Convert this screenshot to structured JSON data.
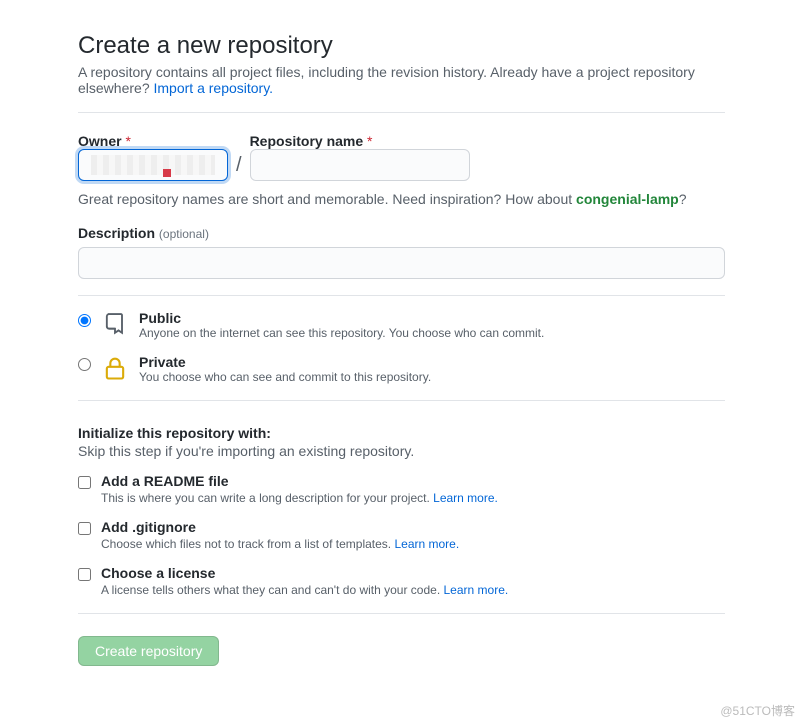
{
  "header": {
    "title": "Create a new repository",
    "subhead_prefix": "A repository contains all project files, including the revision history. Already have a project repository elsewhere? ",
    "import_link": "Import a repository."
  },
  "owner": {
    "label": "Owner",
    "required": "*"
  },
  "repo_name": {
    "label": "Repository name",
    "required": "*"
  },
  "slash": "/",
  "name_hint_prefix": "Great repository names are short and memorable. Need inspiration? How about ",
  "name_suggestion": "congenial-lamp",
  "name_hint_suffix": "?",
  "description": {
    "label": "Description",
    "optional": "(optional)"
  },
  "visibility": {
    "public": {
      "title": "Public",
      "desc": "Anyone on the internet can see this repository. You choose who can commit."
    },
    "private": {
      "title": "Private",
      "desc": "You choose who can see and commit to this repository."
    }
  },
  "init": {
    "title": "Initialize this repository with:",
    "sub": "Skip this step if you're importing an existing repository.",
    "readme": {
      "title": "Add a README file",
      "desc": "This is where you can write a long description for your project. ",
      "learn": "Learn more."
    },
    "gitignore": {
      "title": "Add .gitignore",
      "desc": "Choose which files not to track from a list of templates. ",
      "learn": "Learn more."
    },
    "license": {
      "title": "Choose a license",
      "desc": "A license tells others what they can and can't do with your code. ",
      "learn": "Learn more."
    }
  },
  "submit": "Create repository",
  "watermark": "@51CTO博客"
}
